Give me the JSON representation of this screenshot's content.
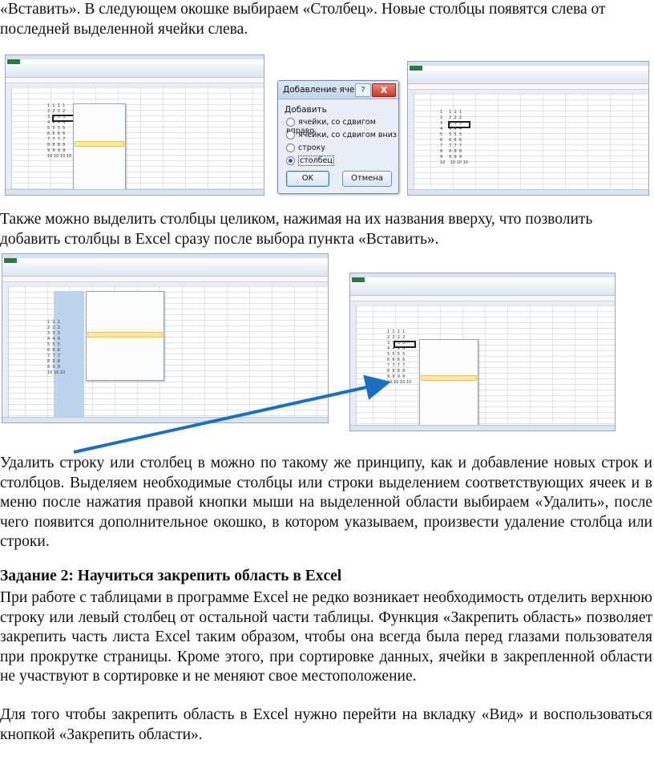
{
  "text": {
    "p1_line1": "«Вставить». В следующем окошке выбираем «Столбец». Новые столбцы появятся слева от",
    "p1_line2": "последней выделенной ячейки слева.",
    "p2_line1": " Также можно выделить столбцы целиком, нажимая на их названия вверху, что позволить",
    "p2_line2": "добавить столбцы в  Excel сразу после выбора пункта «Вставить».",
    "p3": "Удалить строку или столбец в можно по такому же принципу, как и добавление новых строк и столбцов. Выделяем необходимые столбцы или строки выделением соответствующих ячеек и в меню после нажатия правой кнопки мыши на выделенной области выбираем «Удалить», после чего появится дополнительное окошко, в котором указываем, произвести удаление столбца или строки.",
    "task_heading": "Задание 2: Научиться закрепить область в  Excel",
    "p4": "При работе с таблицами в программе Excel не редко возникает необходимость отделить верхнюю строку или левый столбец от остальной части таблицы. Функция «Закрепить область» позволяет закрепить часть листа Excel таким образом, чтобы она всегда была перед глазами пользователя при прокрутке страницы. Кроме этого, при сортировке данных, ячейки в закрепленной области не участвуют в сортировке и не меняют свое местоположение.",
    "p5": "Для того чтобы закрепить область в   Excel нужно перейти на вкладку «Вид» и воспользоваться кнопкой «Закрепить области»."
  },
  "dialog": {
    "title": "Добавление ячеек",
    "help_glyph": "?",
    "close_glyph": "X",
    "group_label": "Добавить",
    "options": [
      {
        "label": "ячейки, со сдвигом вправо",
        "selected": false
      },
      {
        "label": "ячейки, со сдвигом вниз",
        "selected": false
      },
      {
        "label": "строку",
        "selected": false
      },
      {
        "label": "столбец",
        "selected": true
      }
    ],
    "ok_label": "OK",
    "cancel_label": "Отмена"
  },
  "colors": {
    "ribbon": "#dde6f1",
    "file_tab": "#2a7a3d",
    "column_selection": "#bcd3ee",
    "menu_highlight": "#fde9a8",
    "arrow": "#1b6fc0"
  }
}
